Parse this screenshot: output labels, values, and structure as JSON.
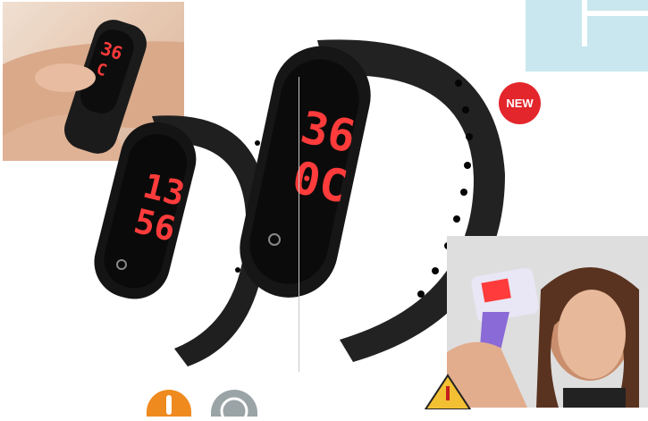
{
  "badge": {
    "label": "NEW"
  },
  "watch_large": {
    "display_top": "36",
    "display_bottom": "0C"
  },
  "watch_small": {
    "display_top": "13",
    "display_bottom": "56"
  },
  "watch_photo": {
    "display_top": "36",
    "display_bottom": "C"
  },
  "colors": {
    "badge": "#e3262b",
    "led": "#ff3b3b",
    "band": "#1e1e1e",
    "accent": "#c9e7ee",
    "thermo": "#ef8a1f"
  },
  "icons": [
    "thermometer-icon",
    "eco-icon",
    "warning-triangle-icon"
  ]
}
